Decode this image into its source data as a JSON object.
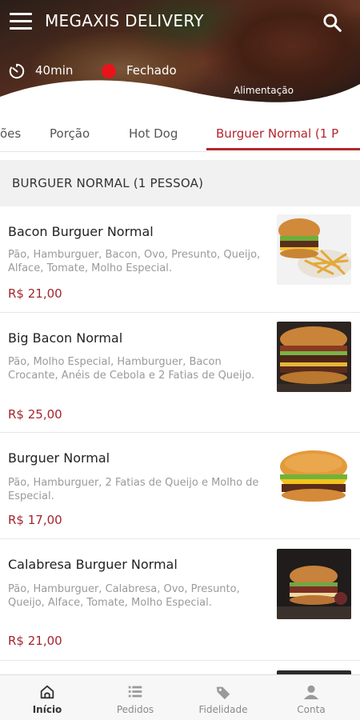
{
  "app": {
    "title": "MEGAXIS DELIVERY"
  },
  "store": {
    "delivery_time": "40min",
    "status": "Fechado",
    "status_color": "#e8141c",
    "category": "Alimentação"
  },
  "tabs": [
    {
      "label": "ões"
    },
    {
      "label": "Porção"
    },
    {
      "label": "Hot Dog"
    },
    {
      "label": "Burguer Normal (1 P",
      "active": true
    }
  ],
  "section": {
    "title": "BURGUER NORMAL (1 PESSOA)"
  },
  "items": [
    {
      "name": "Bacon Burguer Normal",
      "description": "Pão, Hamburguer, Bacon, Ovo, Presunto, Queijo, Alface, Tomate, Molho Especial.",
      "price": "R$ 21,00",
      "image": "burger-with-fries-photo"
    },
    {
      "name": "Big Bacon Normal",
      "description": "Pão, Molho Especial, Hamburguer, Bacon Crocante, Anéis de Cebola e 2 Fatias de Queijo.",
      "price": "R$ 25,00",
      "image": "big-bacon-burger-photo"
    },
    {
      "name": "Burguer Normal",
      "description": "Pão, Hamburguer, 2 Fatias de Queijo e Molho de Especial.",
      "price": "R$ 17,00",
      "image": "cheeseburger-photo"
    },
    {
      "name": "Calabresa Burguer Normal",
      "description": "Pão, Hamburguer, Calabresa, Ovo, Presunto, Queijo, Alface, Tomate, Molho Especial.",
      "price": "R$ 21,00",
      "image": "calabresa-burger-photo"
    }
  ],
  "bottom_nav": [
    {
      "label": "Início",
      "icon": "home-icon",
      "active": true
    },
    {
      "label": "Pedidos",
      "icon": "list-icon"
    },
    {
      "label": "Fidelidade",
      "icon": "tag-icon"
    },
    {
      "label": "Conta",
      "icon": "user-icon"
    }
  ],
  "colors": {
    "accent": "#b3262f",
    "price": "#a5252c",
    "section_bg": "#f1f1f1"
  }
}
